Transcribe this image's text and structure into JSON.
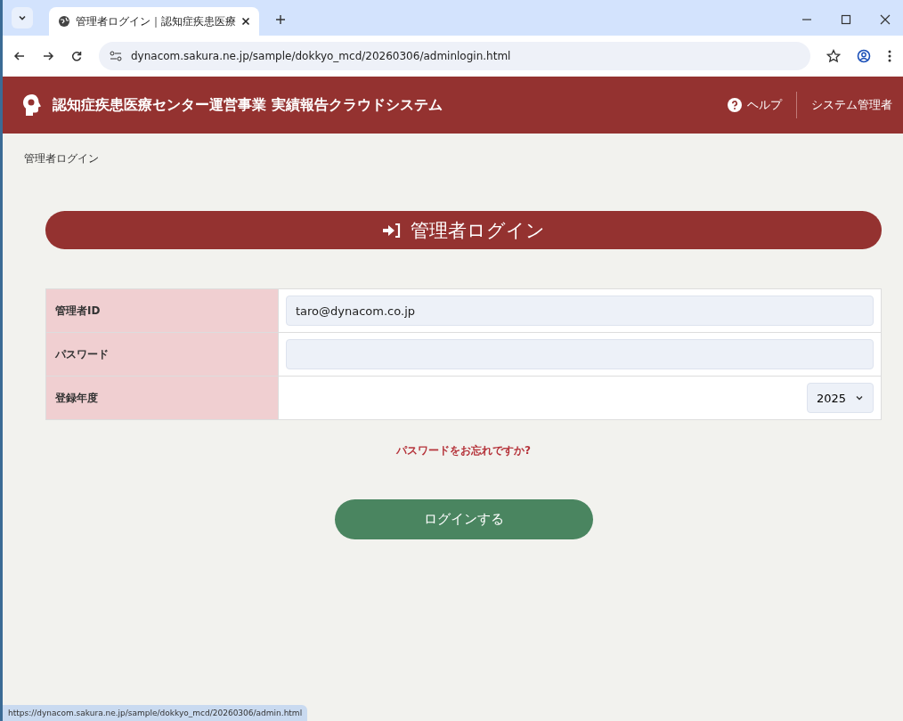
{
  "browser": {
    "tabs": [
      {
        "title": "管理者ログイン｜認知症疾患医療",
        "selected": true
      }
    ],
    "url": "dynacom.sakura.ne.jp/sample/dokkyo_mcd/20260306/adminlogin.html",
    "status_url": "https://dynacom.sakura.ne.jp/sample/dokkyo_mcd/20260306/admin.html"
  },
  "header": {
    "title": "認知症疾患医療センター運営事業 実績報告クラウドシステム",
    "help": "ヘルプ",
    "user": "システム管理者"
  },
  "breadcrumb": "管理者ログイン",
  "page_title": "管理者ログイン",
  "form": [
    {
      "label": "管理者ID",
      "kind": "text",
      "value": "taro@dynacom.co.jp"
    },
    {
      "label": "パスワード",
      "kind": "password"
    },
    {
      "label": "登録年度",
      "kind": "select",
      "value": "2025"
    }
  ],
  "forgot_link": "パスワードをお忘れですか?",
  "login_button": "ログインする"
}
